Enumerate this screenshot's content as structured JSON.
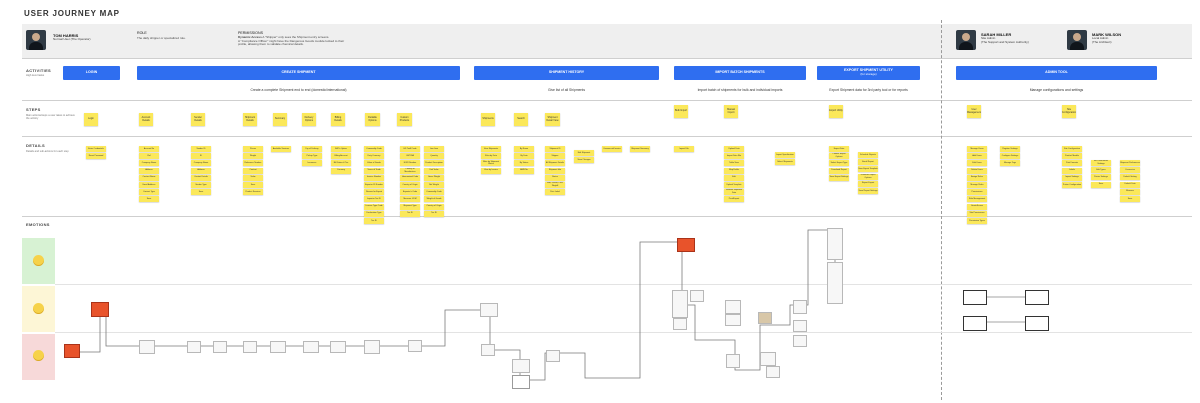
{
  "page": {
    "title": "USER JOURNEY MAP"
  },
  "persona1": {
    "name": "TOM HARRIS",
    "subtitle": "Normal User (The Operator)",
    "role_label": "ROLE",
    "role_text": "The daily shipper or specialized role.",
    "perm_label": "PERMISSIONS",
    "perm_title": "Dynamic Access",
    "perm_text1": "A \"Shipper\" only sees the Shipment entry screens.",
    "perm_text2": "A \"Compliance Officer\" might have the Dangerous Goods module locked to their",
    "perm_text3": "profile, allowing them to validate chemical details."
  },
  "persona2": {
    "name": "SARAH MILLER",
    "role": "Site Admin",
    "desc": "(The Support and System Authority)"
  },
  "persona3": {
    "name": "MARK WILSON",
    "role": "Local Admin",
    "desc": "(The Architect)"
  },
  "rows": {
    "activities": "ACTIVITIES",
    "activities_sub": "High level tasks",
    "steps": "STEPS",
    "steps_sub": "Main actions/steps a user takes to achieve the activity",
    "details": "DETAILS",
    "details_sub": "Details and sub-actions for each step",
    "emotions": "EMOTIONS"
  },
  "activities": [
    {
      "label": "LOGIN"
    },
    {
      "label": "CREATE SHIPMENT"
    },
    {
      "label": "SHIPMENT HISTORY"
    },
    {
      "label": "IMPORT BATCH SHIPMENTS"
    },
    {
      "label": "EXPORT SHIPMENT UTILITY",
      "sub": "(for storage)"
    },
    {
      "label": "ADMIN TOOL"
    }
  ],
  "descriptions": [
    "Create a complete Shipment end to end (domestic/international)",
    "Give list of all Shipments",
    "Import batch of shipments for bulk and individual imports",
    "Export Shipment data for 3rd party tool or for reports",
    "Manage configurations and settings"
  ],
  "steps": [
    {
      "label": "Login"
    },
    {
      "label": "Account Details"
    },
    {
      "label": "Sender Details"
    },
    {
      "label": "Shipment Details"
    },
    {
      "label": "Summary"
    },
    {
      "label": "Delivery Options"
    },
    {
      "label": "Billing Details"
    },
    {
      "label": "Dutiable Options"
    },
    {
      "label": "Custom Products"
    },
    {
      "label": "Shipments"
    },
    {
      "label": "Search"
    },
    {
      "label": "Shipment Detail View"
    },
    {
      "label": "Bulk Import"
    },
    {
      "label": "Manual Import"
    },
    {
      "label": "Export Utility"
    },
    {
      "label": "User Management"
    },
    {
      "label": "Site Configuration"
    }
  ],
  "extra_steps": [
    "Sender ID Number",
    "Save as Preset",
    "Recipient Details"
  ],
  "details": {
    "login": [
      "Enter Credentials",
      "Reset Password"
    ],
    "account": [
      "Account No",
      "Ref",
      "Company Name",
      "Address",
      "Contact Name",
      "Email Address",
      "Contact Type",
      "Save"
    ],
    "sender": [
      "Sender ID",
      "ID",
      "Company Name",
      "Address",
      "Contact Details",
      "Sender Type",
      "Save"
    ],
    "shipment": [
      "Pieces",
      "Weight",
      "Reference Number",
      "Content",
      "Value",
      "Save",
      "Product Services"
    ],
    "summary": [
      "Available Services"
    ],
    "delivery": [
      "Dry of Delivery",
      "Pickup Type",
      "Insurance"
    ],
    "billing": [
      "Bill To Option",
      "Billing Account",
      "Bill Duties & Tax",
      "Currency"
    ],
    "dutiable": [
      "Commodity Code",
      "Duty Currency",
      "Value of Goods",
      "Terms of Trade",
      "Invoice Number",
      "Exporter ID Number",
      "Reason for Export",
      "Importer Tax ID",
      "License Type Code",
      "Declaration Type",
      "Tax ID"
    ],
    "dutiable2": [
      "HS Tariff Code",
      "GST/IVA",
      "EORI Number",
      "Country of Manufacture",
      "Harmonized Code",
      "Country of Origin",
      "Exporter's Code",
      "Measure UOM",
      "Shipment Type",
      "Tax ID"
    ],
    "custom": [
      "Line Item",
      "Quantity",
      "Product Description",
      "Unit Value",
      "Gross Weight",
      "Net Weight",
      "Commodity Code",
      "Weight of Goods",
      "Country of Origin",
      "Tax ID"
    ],
    "shipments": [
      "View Shipments",
      "Filter by Date",
      "Filter by Shipment Status",
      "View by Invoice"
    ],
    "search": [
      "By Name",
      "By Date",
      "By Status",
      "AWB No"
    ],
    "detailview": [
      "Shipment ID",
      "Shipper",
      "All Shipment Details",
      "Shipment Info",
      "Status",
      "Edit, Delete, Print Waybill",
      "Print Label"
    ],
    "detailview2": [
      "Edit Shipment",
      "Save Changes"
    ],
    "detailview3": [
      "Commercial Invoice"
    ],
    "detailview4": [
      "Shipment Summary"
    ],
    "bulk": [
      "Import File"
    ],
    "manual": [
      "Upload Data",
      "Import Data File",
      "Table View",
      "Map Fields",
      "Edit",
      "Upload Template",
      "Validate Shipment Data",
      "Print/Export"
    ],
    "manual2": [
      "Import Specification",
      "Select Shipments"
    ],
    "export": [
      "Export Data",
      "Choose Export Options",
      "Select Export Type",
      "Download Report",
      "Save Export Settings"
    ],
    "export2": [
      "Schedule Reports",
      "Email Report",
      "Save Export Template",
      "Schedule Report Options",
      "Report Export",
      "Save Report Settings"
    ],
    "users": [
      "Manage Users",
      "Add Users",
      "Edit Users",
      "Delete Users",
      "Assign Roles",
      "Manage Roles",
      "Permissions",
      "Role Management",
      "Grant Access",
      "Site Permissions",
      "Permission Types"
    ],
    "users2": [
      "Register Settings",
      "Configure Settings",
      "Manage Tags"
    ],
    "siteconf": [
      "Site Configuration",
      "Product Models",
      "Print Formats",
      "Labels",
      "Import Settings",
      "Printer Configuration"
    ],
    "siteconf2": [
      "Set Preferences Settings",
      "Edit Types",
      "Printer Settings",
      "Save"
    ],
    "siteconf3": [
      "Shipment Preferences",
      "Currencies",
      "Default Setting",
      "Default Date",
      "Measure",
      "Save"
    ]
  },
  "icons": {
    "face_happy": "happy-face-icon",
    "face_neutral": "neutral-face-icon",
    "face_sad": "sad-face-icon"
  },
  "colors": {
    "activity": "#2f6ef0",
    "sticky": "#fbe85a",
    "happy_band": "#d7f2d3",
    "neutral_band": "#fdf6d6",
    "sad_band": "#f7d9d9"
  }
}
